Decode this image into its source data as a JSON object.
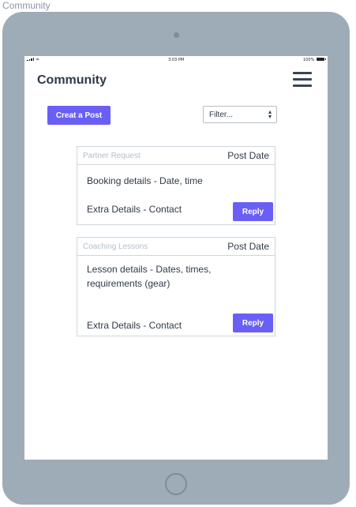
{
  "frame_label": "Community",
  "status_bar": {
    "time": "3:03 PM",
    "battery": "100%"
  },
  "header": {
    "title": "Community"
  },
  "toolbar": {
    "create_label": "Creat a Post",
    "filter_value": "Filter..."
  },
  "posts": [
    {
      "type": "Partner Request",
      "date_label": "Post Date",
      "details": "Booking details - Date, time",
      "extra": "Extra Details - Contact",
      "reply_label": "Reply"
    },
    {
      "type": "Coaching Lessons",
      "date_label": "Post Date",
      "details": "Lesson details - Dates, times, requirements (gear)",
      "extra": "Extra Details - Contact",
      "reply_label": "Reply"
    }
  ],
  "colors": {
    "accent": "#6a5ff5",
    "device": "#9eacb8",
    "text": "#2f3a48"
  },
  "icons": {
    "menu": "hamburger-icon",
    "filter": "select-caret-icon"
  }
}
